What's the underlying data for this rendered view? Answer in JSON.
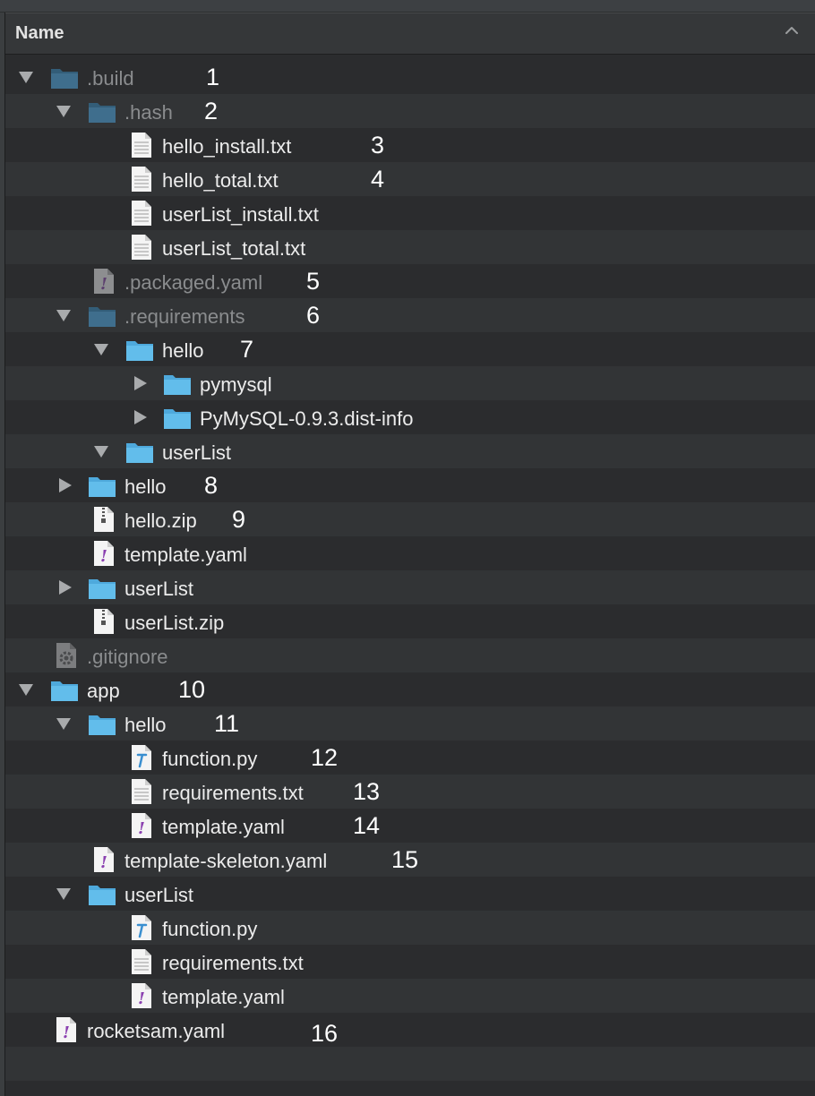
{
  "header": {
    "column_name": "Name"
  },
  "rows": [
    {
      "label": ".build",
      "number": "1",
      "icon": "folder-icon",
      "dim": true
    },
    {
      "label": ".hash",
      "number": "2",
      "icon": "folder-icon",
      "dim": true
    },
    {
      "label": "hello_install.txt",
      "number": "3",
      "icon": "text-file-icon"
    },
    {
      "label": "hello_total.txt",
      "number": "4",
      "icon": "text-file-icon"
    },
    {
      "label": "userList_install.txt",
      "number": "",
      "icon": "text-file-icon"
    },
    {
      "label": "userList_total.txt",
      "number": "",
      "icon": "text-file-icon"
    },
    {
      "label": ".packaged.yaml",
      "number": "5",
      "icon": "yaml-file-icon",
      "dim": true
    },
    {
      "label": ".requirements",
      "number": "6",
      "icon": "folder-icon",
      "dim": true
    },
    {
      "label": "hello",
      "number": "7",
      "icon": "folder-icon"
    },
    {
      "label": "pymysql",
      "number": "",
      "icon": "folder-icon"
    },
    {
      "label": "PyMySQL-0.9.3.dist-info",
      "number": "",
      "icon": "folder-icon"
    },
    {
      "label": "userList",
      "number": "",
      "icon": "folder-icon"
    },
    {
      "label": "hello",
      "number": "8",
      "icon": "folder-icon"
    },
    {
      "label": "hello.zip",
      "number": "9",
      "icon": "zip-file-icon"
    },
    {
      "label": "template.yaml",
      "number": "",
      "icon": "yaml-file-icon"
    },
    {
      "label": "userList",
      "number": "",
      "icon": "folder-icon"
    },
    {
      "label": "userList.zip",
      "number": "",
      "icon": "zip-file-icon"
    },
    {
      "label": ".gitignore",
      "number": "",
      "icon": "gear-file-icon",
      "dim": true
    },
    {
      "label": "app",
      "number": "10",
      "icon": "folder-icon"
    },
    {
      "label": "hello",
      "number": "11",
      "icon": "folder-icon"
    },
    {
      "label": "function.py",
      "number": "12",
      "icon": "python-file-icon"
    },
    {
      "label": "requirements.txt",
      "number": "13",
      "icon": "text-file-icon"
    },
    {
      "label": "template.yaml",
      "number": "14",
      "icon": "yaml-file-icon"
    },
    {
      "label": "template-skeleton.yaml",
      "number": "15",
      "icon": "yaml-file-icon"
    },
    {
      "label": "userList",
      "number": "",
      "icon": "folder-icon"
    },
    {
      "label": "function.py",
      "number": "",
      "icon": "python-file-icon"
    },
    {
      "label": "requirements.txt",
      "number": "",
      "icon": "text-file-icon"
    },
    {
      "label": "template.yaml",
      "number": "",
      "icon": "yaml-file-icon"
    },
    {
      "label": "rocketsam.yaml",
      "number": "16",
      "icon": "yaml-file-icon"
    }
  ]
}
